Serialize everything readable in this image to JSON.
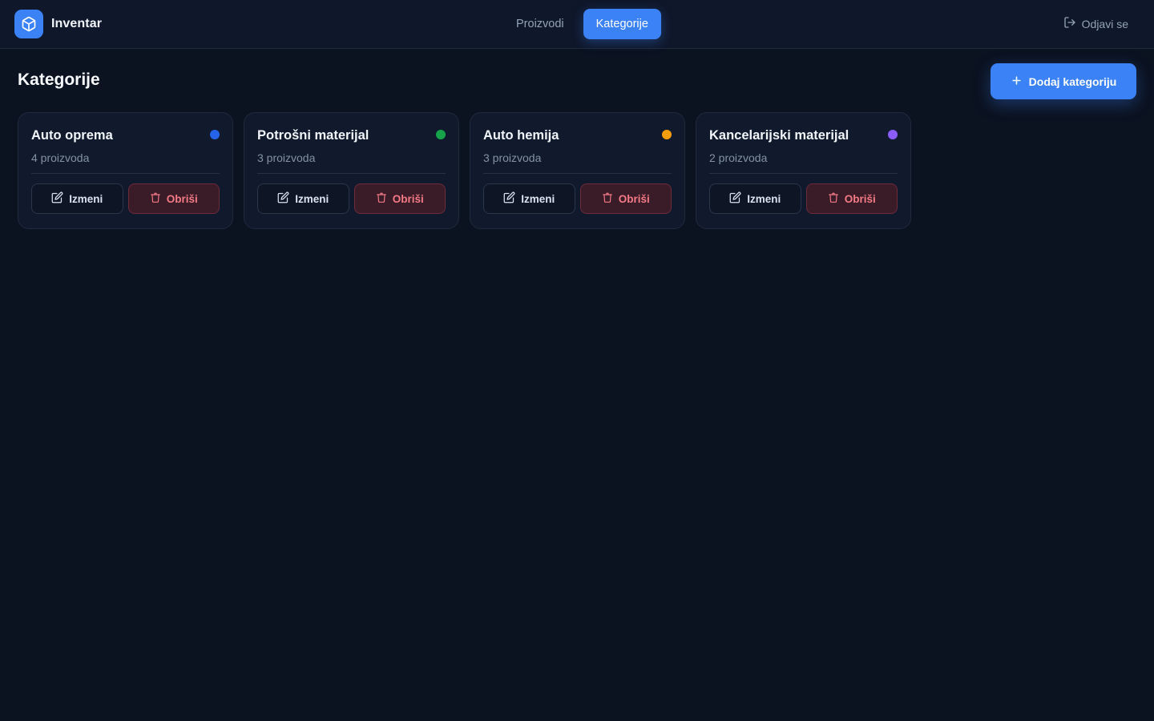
{
  "app": {
    "name": "Inventar",
    "logo_icon": "cube-icon"
  },
  "nav": {
    "tabs": [
      {
        "label": "Proizvodi",
        "active": false
      },
      {
        "label": "Kategorije",
        "active": true
      }
    ]
  },
  "header": {
    "logout_label": "Odjavi se"
  },
  "page": {
    "title": "Kategorije",
    "add_label": "Dodaj kategoriju"
  },
  "categories": [
    {
      "name": "Auto oprema",
      "count": "4 proizvoda",
      "color": "#2563eb",
      "edit_label": "Izmeni",
      "delete_label": "Obriši"
    },
    {
      "name": "Potrošni materijal",
      "count": "3 proizvoda",
      "color": "#16a34a",
      "edit_label": "Izmeni",
      "delete_label": "Obriši"
    },
    {
      "name": "Auto hemija",
      "count": "3 proizvoda",
      "color": "#f59e0b",
      "edit_label": "Izmeni",
      "delete_label": "Obriši"
    },
    {
      "name": "Kancelarijski materijal",
      "count": "2 proizvoda",
      "color": "#8b5cf6",
      "edit_label": "Izmeni",
      "delete_label": "Obriši"
    }
  ],
  "colors": {
    "accent": "#3b82f6",
    "background": "#0b1220",
    "danger": "#f47a86"
  }
}
